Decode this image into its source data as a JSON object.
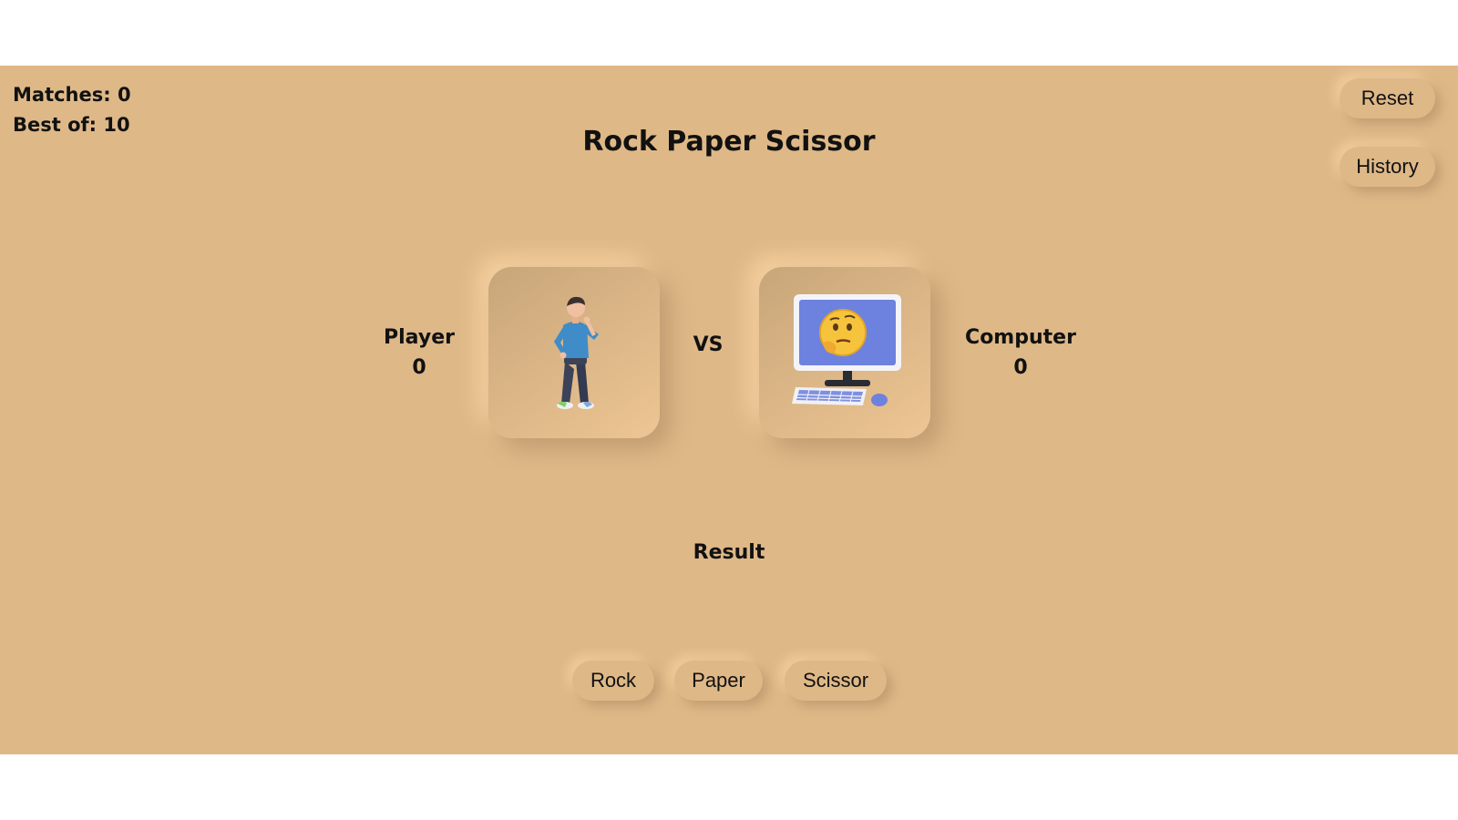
{
  "stats": {
    "matches_label": "Matches: 0",
    "best_of_label": "Best of: 10"
  },
  "title": "Rock Paper Scissor",
  "controls": {
    "reset_label": "Reset",
    "history_label": "History"
  },
  "player": {
    "name": "Player",
    "score": "0"
  },
  "computer": {
    "name": "Computer",
    "score": "0"
  },
  "vs_label": "VS",
  "result_label": "Result",
  "choices": {
    "rock": "Rock",
    "paper": "Paper",
    "scissor": "Scissor"
  },
  "colors": {
    "background": "#deb887",
    "text": "#111111"
  }
}
